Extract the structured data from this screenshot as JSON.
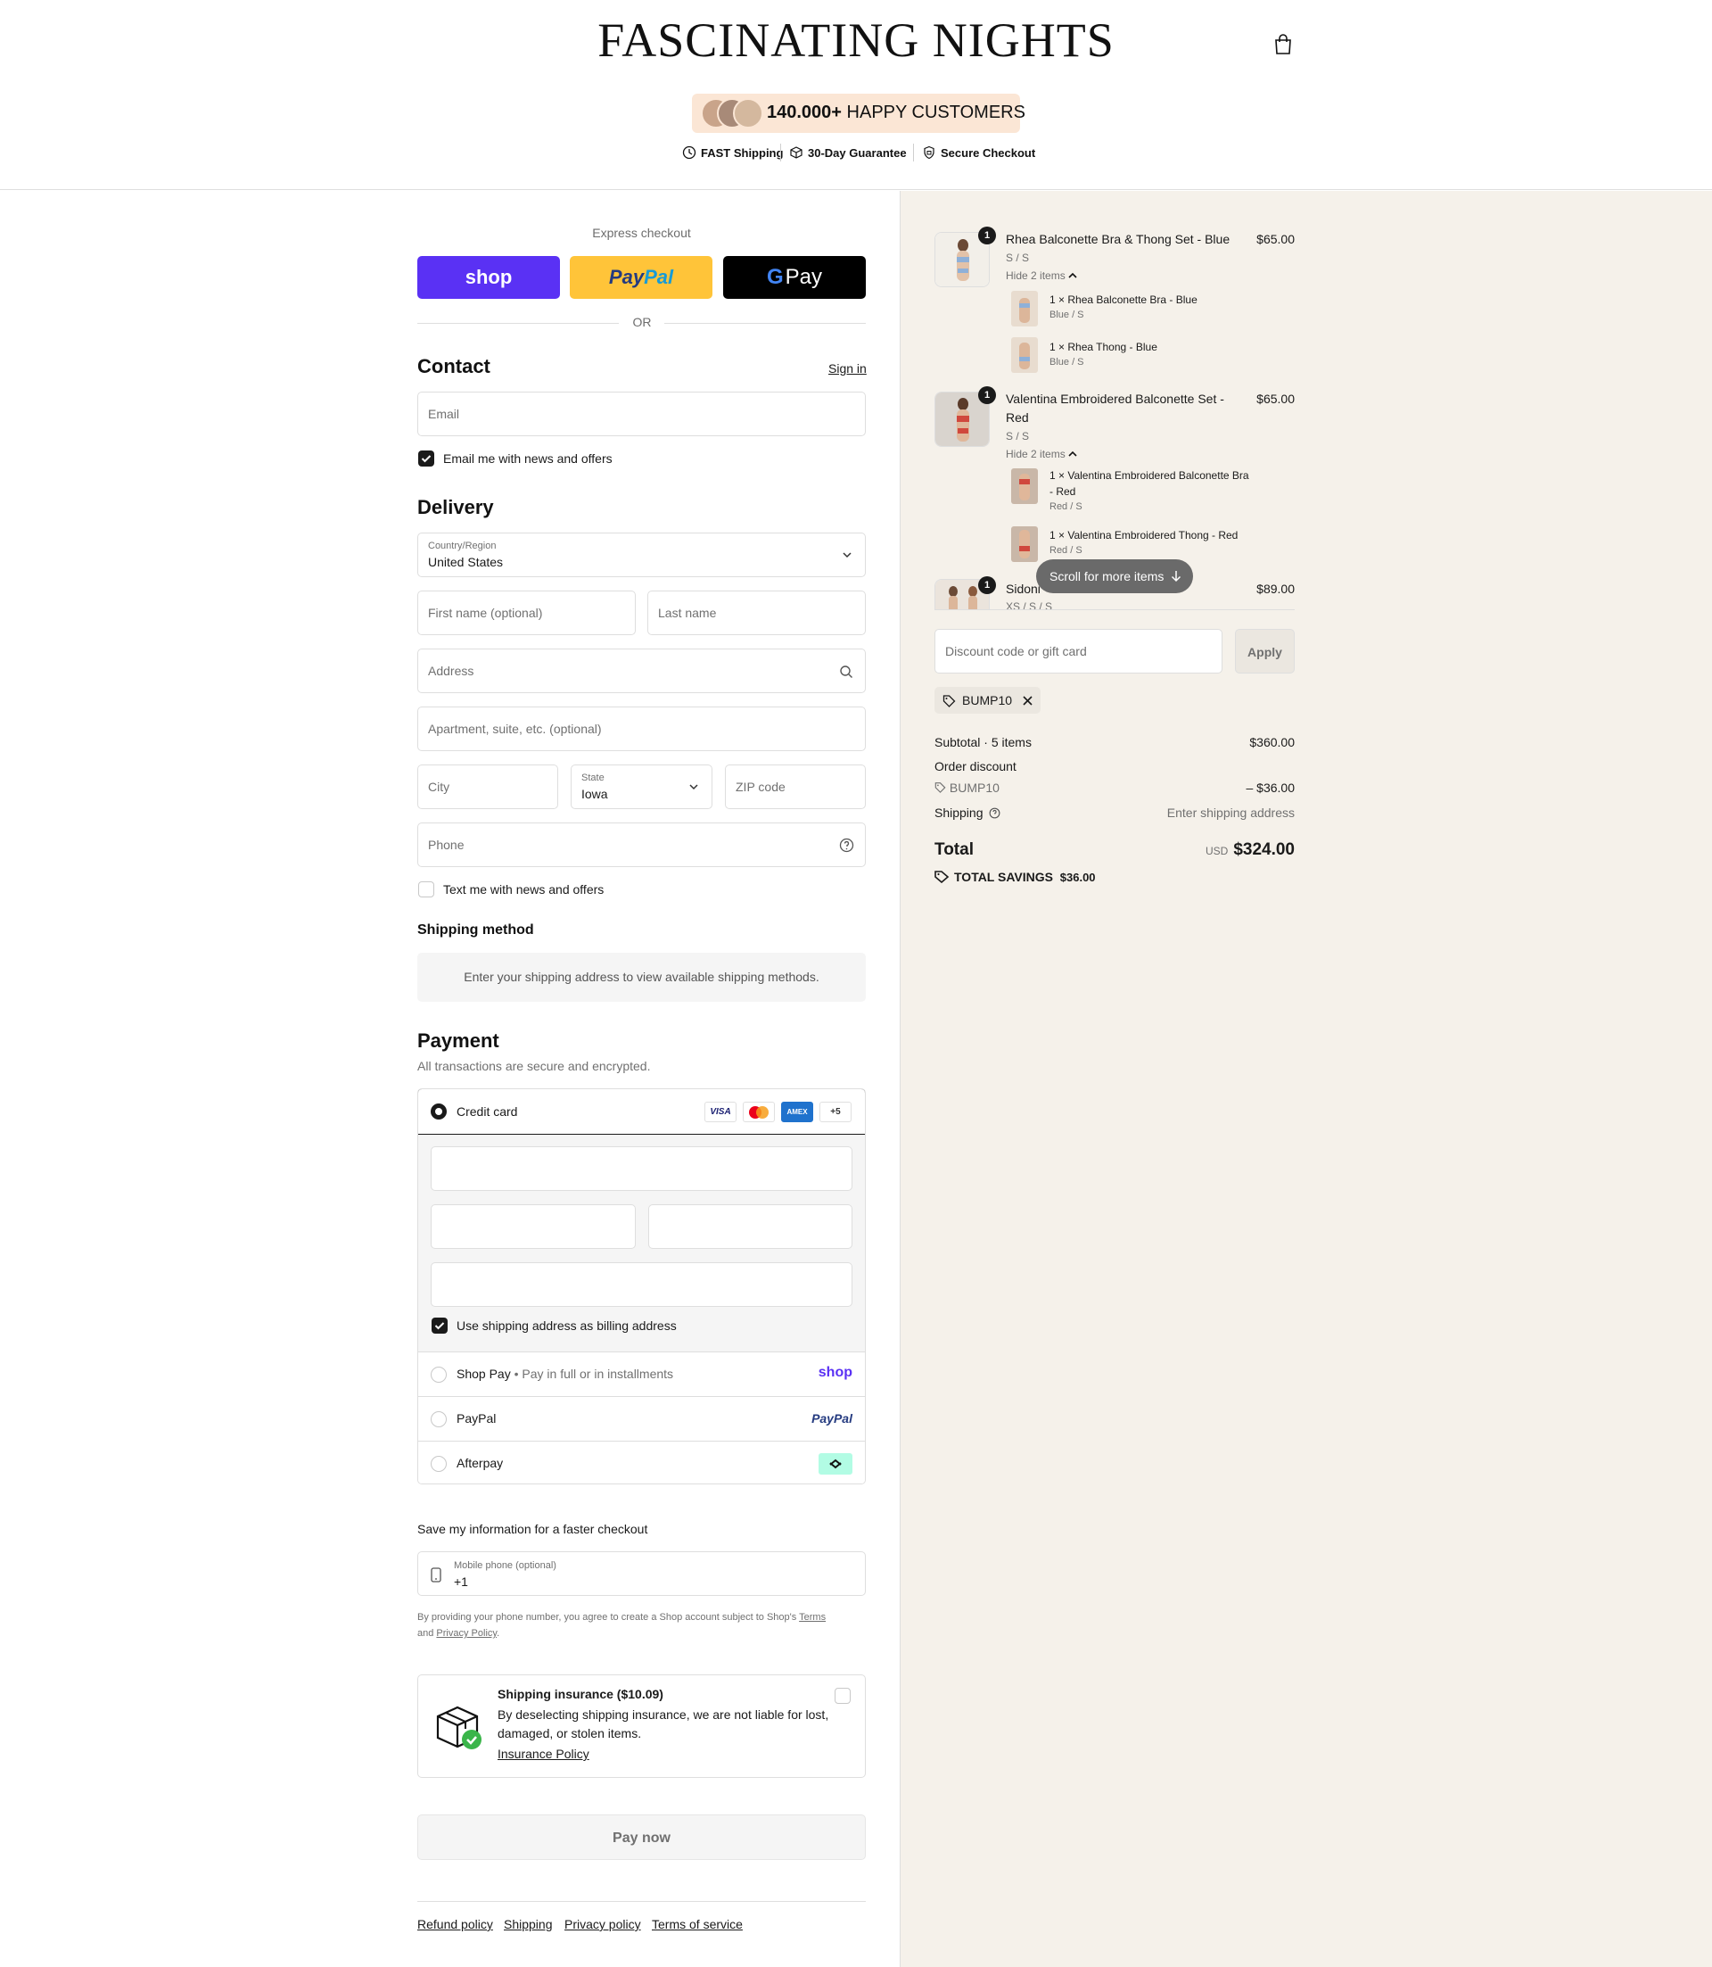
{
  "header": {
    "logo": "FASCINATING NIGHTS",
    "badge_count": "140.000+",
    "badge_text": " HAPPY CUSTOMERS",
    "trust": [
      "FAST Shipping",
      "30-Day Guarantee",
      "Secure Checkout"
    ]
  },
  "express": {
    "title": "Express checkout",
    "shop_label": "shop",
    "paypal_label_1": "Pay",
    "paypal_label_2": "Pal",
    "gpay_label": "Pay",
    "or": "OR"
  },
  "contact": {
    "heading": "Contact",
    "sign_in": "Sign in",
    "email_placeholder": "Email",
    "news_label": "Email me with news and offers"
  },
  "delivery": {
    "heading": "Delivery",
    "country_label": "Country/Region",
    "country_value": "United States",
    "first_name": "First name (optional)",
    "last_name": "Last name",
    "address": "Address",
    "apartment": "Apartment, suite, etc. (optional)",
    "city": "City",
    "state_label": "State",
    "state_value": "Iowa",
    "zip": "ZIP code",
    "phone": "Phone",
    "text_label": "Text me with news and offers"
  },
  "shipping_method": {
    "heading": "Shipping method",
    "message": "Enter your shipping address to view available shipping methods."
  },
  "payment": {
    "heading": "Payment",
    "subtitle": "All transactions are secure and encrypted.",
    "credit_card": "Credit card",
    "card_logos": [
      "VISA",
      "MC",
      "AMEX",
      "+5"
    ],
    "billing_label": "Use shipping address as billing address",
    "shop_pay": "Shop Pay",
    "shop_pay_sub": "Pay in full or in installments",
    "shop_pay_logo": "shop",
    "paypal": "PayPal",
    "paypal_logo": "PayPal",
    "afterpay": "Afterpay"
  },
  "save_info": {
    "heading": "Save my information for a faster checkout",
    "phone_label": "Mobile phone (optional)",
    "phone_value": "+1",
    "legal_1": "By providing your phone number, you agree to create a Shop account subject to Shop's ",
    "legal_terms": "Terms",
    "legal_and": "and ",
    "legal_privacy": "Privacy Policy",
    "legal_end": "."
  },
  "insurance": {
    "title": "Shipping insurance ($10.09)",
    "body": "By deselecting shipping insurance, we are not liable for lost, damaged, or stolen items.",
    "link": "Insurance Policy"
  },
  "pay_now": "Pay now",
  "footer": [
    "Refund policy",
    "Shipping",
    "Privacy policy",
    "Terms of service"
  ],
  "cart": {
    "items": [
      {
        "qty": "1",
        "name": "Rhea Balconette Bra & Thong Set - Blue",
        "variant": "S / S",
        "price": "$65.00",
        "hide": "Hide 2 items",
        "children": [
          {
            "name": "1 × Rhea Balconette Bra - Blue",
            "variant": "Blue / S"
          },
          {
            "name": "1 × Rhea Thong - Blue",
            "variant": "Blue / S"
          }
        ]
      },
      {
        "qty": "1",
        "name_1": "Valentina Embroidered Balconette Set -",
        "name_2": "Red",
        "variant": "S / S",
        "price": "$65.00",
        "hide": "Hide 2 items",
        "children": [
          {
            "name_1": "1 × Valentina Embroidered Balconette Bra",
            "name_2": "- Red",
            "variant": "Red / S"
          },
          {
            "name": "1 × Valentina Embroidered Thong - Red",
            "variant": "Red / S"
          }
        ]
      },
      {
        "qty": "1",
        "name": "Sidoni",
        "variant": "XS / S / S",
        "price": "$89.00"
      }
    ],
    "scroll_hint": "Scroll for more items",
    "discount_placeholder": "Discount code or gift card",
    "apply": "Apply",
    "code": "BUMP10",
    "subtotal_label": "Subtotal · 5 items",
    "subtotal": "$360.00",
    "order_discount": "Order discount",
    "discount_code": "BUMP10",
    "discount_value": "– $36.00",
    "shipping_label": "Shipping",
    "shipping_value": "Enter shipping address",
    "total_label": "Total",
    "currency": "USD",
    "total": "$324.00",
    "savings_label": "TOTAL SAVINGS",
    "savings": "$36.00"
  }
}
